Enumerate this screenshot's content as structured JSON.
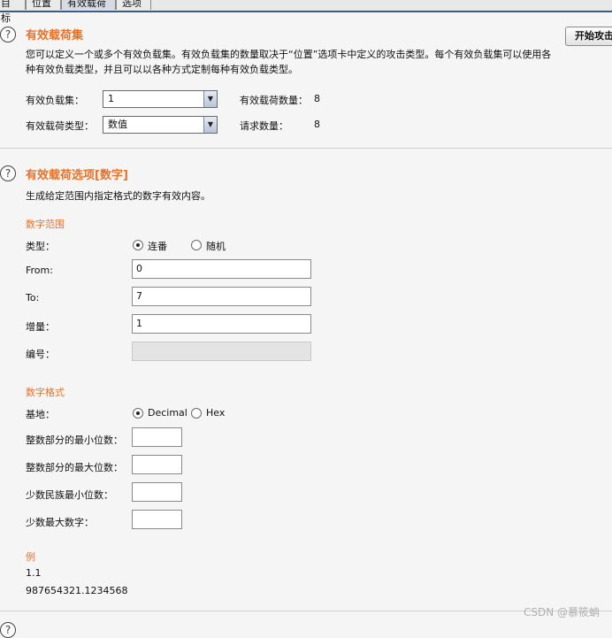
{
  "tabs": [
    {
      "label": "目标"
    },
    {
      "label": "位置"
    },
    {
      "label": "有效载荷"
    },
    {
      "label": "选项"
    }
  ],
  "help_glyph": "?",
  "payload_sets": {
    "title": "有效载荷集",
    "start_button": "开始攻击",
    "description": "您可以定义一个或多个有效负载集。有效负载集的数量取决于“位置”选项卡中定义的攻击类型。每个有效负载集可以使用各种有效负载类型，并且可以以各种方式定制每种有效负载类型。",
    "set_label": "有效负载集：",
    "set_value": "1",
    "type_label": "有效载荷类型：",
    "type_value": "数值",
    "count_label": "有效载荷数量：",
    "count_value": "8",
    "requests_label": "请求数量：",
    "requests_value": "8"
  },
  "payload_options": {
    "title": "有效载荷选项[数字]",
    "description": "生成给定范围内指定格式的数字有效内容。",
    "range_heading": "数字范围",
    "type_label": "类型：",
    "type_options": [
      "连番",
      "随机"
    ],
    "type_selected": 0,
    "from_label": "From:",
    "from_value": "0",
    "to_label": "To:",
    "to_value": "7",
    "step_label": "增量：",
    "step_value": "1",
    "howmany_label": "编号：",
    "howmany_value": "",
    "format_heading": "数字格式",
    "base_label": "基地：",
    "base_options": [
      "Decimal",
      "Hex"
    ],
    "base_selected": 0,
    "min_int_label": "整数部分的最小位数：",
    "min_int_value": "",
    "max_int_label": "整数部分的最大位数：",
    "max_int_value": "",
    "min_frac_label": "少数民族最小位数：",
    "min_frac_value": "",
    "max_frac_label": "少数最大数字：",
    "max_frac_value": "",
    "example_heading": "例",
    "example_1": "1.1",
    "example_2": "987654321.1234568"
  },
  "watermark": "CSDN @慕筱蚺"
}
